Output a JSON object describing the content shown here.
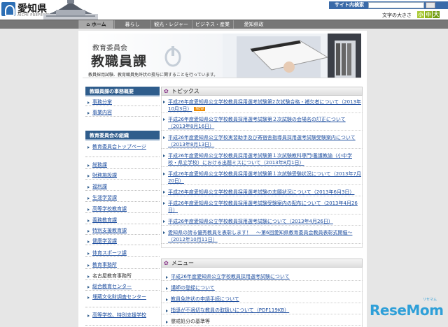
{
  "header": {
    "site_name": "愛知県",
    "site_sub": "AICHI PREFECTURE",
    "search_label": "サイト内検索",
    "fontsize_label": "文字の大きさ",
    "fontsize_buttons": [
      "小",
      "中",
      "大"
    ]
  },
  "nav": [
    "ホーム",
    "暮らし",
    "観光・レジャー",
    "ビジネス・産業",
    "愛知県政"
  ],
  "banner": {
    "subtitle": "教育委員会",
    "title": "教職員課",
    "description": "教員採用試験、教育職員免許状の授与に関することを行っています。"
  },
  "sidebar": {
    "section1_title": "教職員課の事務概要",
    "section1_items": [
      "事務分掌",
      "事業内容"
    ],
    "section2_title": "教育委員会の組織",
    "section2_items": [
      "教育委員会トップページ",
      "総務課",
      "財務施設課",
      "福利課",
      "生涯学習課",
      "高等学校教育課",
      "義務教育課",
      "特別支援教育課",
      "健康学習課",
      "体育スポーツ課",
      "教育事務所",
      "名古屋教育事務所",
      "総合教育センター",
      "埋蔵文化財調査センター",
      "高等学校、特別支援学校"
    ]
  },
  "topics": {
    "title": "トピックス",
    "new_badge": "NEW",
    "items": [
      {
        "line1": "平成26年度愛知県公立学校教員採用選考試験第2次試験合格・補欠者について（2013年",
        "line2": "10月3日）",
        "new": true
      },
      {
        "line1": "平成26年度愛知県公立学校教員採用選考試験第２次試験の会場名の訂正について",
        "line2": "（2013年8月16日）",
        "new": false
      },
      {
        "line1": "平成26年度愛知県公立学校実習助手及び寄宿舎指導員採用選考試験受験案内について",
        "line2": "（2013年8月13日）",
        "new": false
      },
      {
        "line1": "平成26年度愛知県公立学校教員採用選考試験第１次試験教科専門Ⅰ養護教諭（小中学",
        "line2": "校・県立学校）における出題ミスについて（2013年8月1日）",
        "new": false
      },
      {
        "line1": "平成26年度愛知県公立学校教員採用選考試験第１次試験受験状況について（2013年7月",
        "line2": "20日）",
        "new": false
      },
      {
        "line1": "平成26年度愛知県公立学校教員採用選考試験の志願状況について（2013年6月3日）",
        "line2": "",
        "new": false
      },
      {
        "line1": "平成26年度愛知県公立学校教員採用選考試験受験案内の配布について（2013年4月26",
        "line2": "日）",
        "new": false
      },
      {
        "line1": "平成26年度愛知県公立学校教員採用選考試験について（2013年4月26日）",
        "line2": "",
        "new": false
      },
      {
        "line1": "愛知県の誇る優秀教員を表彰します！　～第6回愛知県教育委員会教員表彰式開催～",
        "line2": "（2012年10月11日）",
        "new": false
      }
    ]
  },
  "menu": {
    "title": "メニュー",
    "items": [
      "平成26年度愛知県公立学校教員採用選考試験について",
      "講師の登録について",
      "教員免許状の申請手続について",
      "指導が不適切な教員の取扱いについて（PDF119KB）",
      "懲戒処分の基準等"
    ]
  },
  "watermark": {
    "brand": "ReseMom",
    "kana": "リセマム"
  },
  "colors": {
    "nav_bg": "#777777",
    "sidebar_head": "#2f5d8c",
    "link": "#1f4fa0",
    "new_badge": "#f08c00",
    "watermark": "#2e9fd8"
  }
}
